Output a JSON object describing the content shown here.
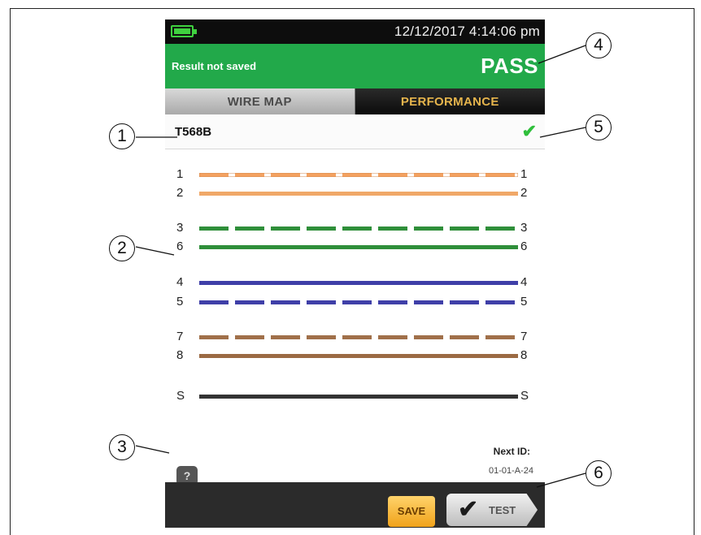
{
  "status_bar": {
    "datetime": "12/12/2017 4:14:06 pm",
    "battery_icon": "battery-icon"
  },
  "result_bar": {
    "save_status": "Result not saved",
    "result": "PASS",
    "color": "#22a94a"
  },
  "tabs": [
    {
      "label": "WIRE MAP",
      "active": true
    },
    {
      "label": "PERFORMANCE",
      "active": false
    }
  ],
  "wire_map": {
    "standard": "T568B",
    "status_icon": "check-icon",
    "pairs": [
      {
        "left": "1",
        "right": "1",
        "color": "orange-white"
      },
      {
        "left": "2",
        "right": "2",
        "color": "orange"
      },
      {
        "left": "3",
        "right": "3",
        "color": "green-white"
      },
      {
        "left": "6",
        "right": "6",
        "color": "green"
      },
      {
        "left": "4",
        "right": "4",
        "color": "blue"
      },
      {
        "left": "5",
        "right": "5",
        "color": "blue-white"
      },
      {
        "left": "7",
        "right": "7",
        "color": "brown-white"
      },
      {
        "left": "8",
        "right": "8",
        "color": "brown"
      },
      {
        "left": "S",
        "right": "S",
        "color": "shield"
      }
    ]
  },
  "help_button": {
    "label": "?"
  },
  "next_id": {
    "label": "Next ID:",
    "value": "01-01-A-24"
  },
  "bottom_bar": {
    "save_label": "SAVE",
    "test_label": "TEST",
    "test_icon": "check-icon"
  },
  "callouts": [
    "1",
    "2",
    "3",
    "4",
    "5",
    "6"
  ]
}
